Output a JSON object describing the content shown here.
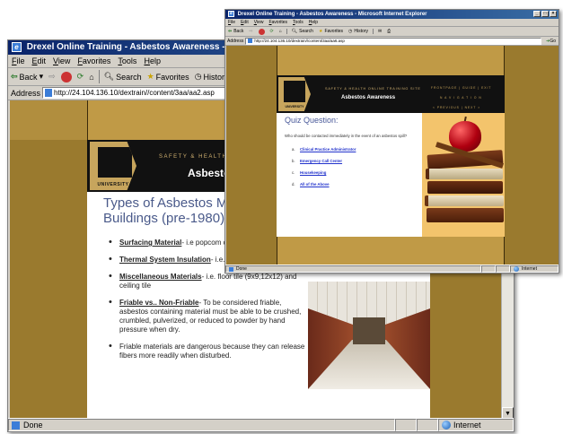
{
  "back_window": {
    "title": "Drexel Online Training - Asbestos Awareness - Microsoft Internet Explorer",
    "menu": [
      "File",
      "Edit",
      "View",
      "Favorites",
      "Tools",
      "Help"
    ],
    "toolbar": {
      "back": "Back",
      "search": "Search",
      "favorites": "Favorites",
      "history": "History"
    },
    "address_label": "Address",
    "address_url": "http://24.104.136.10/dextrain//content/3aa/aa2.asp",
    "status": "Done",
    "zone": "Internet",
    "page": {
      "site_name": "SAFETY & HEALTH ONL",
      "course_title": "Asbestos Aw",
      "logo_text": "UNIVERSITY",
      "heading_line1": "Types of Asbestos Materi",
      "heading_line2": "Buildings (pre-1980)",
      "items": [
        {
          "term": "Surfacing Material",
          "desc": "- i.e popcom ceili"
        },
        {
          "term": "Thermal System Insulation",
          "desc": "- i.e. pip"
        },
        {
          "term": "Miscellaneous Materials",
          "desc": "- i.e. floor tile (9x9,12x12) and ceiling tile"
        },
        {
          "term": "Friable vs.. Non-Friable",
          "desc": "- To be considered friable, asbestos containing material must be able to be crushed, crumbled, pulverized, or reduced to powder by hand pressure when dry."
        },
        {
          "term": "",
          "desc": "Friable materials are dangerous because they can release fibers more readily when disturbed."
        }
      ]
    }
  },
  "front_window": {
    "title": "Drexel Online Training - Asbestos Awareness - Microsoft Internet Explorer",
    "menu": [
      "File",
      "Edit",
      "View",
      "Favorites",
      "Tools",
      "Help"
    ],
    "toolbar": {
      "back": "Back",
      "search": "Search",
      "favorites": "Favorites",
      "history": "History"
    },
    "address_label": "Address",
    "address_url": "http://24.104.136.10/dextrain//content/3aa/aa6.asp",
    "go": "Go",
    "status": "Done",
    "zone": "Internet",
    "page": {
      "site_name": "SAFETY & HEALTH ONLINE TRAINING SITE",
      "course_title": "Asbestos Awareness",
      "logo_text": "UNIVERSITY",
      "nav": {
        "top": "FRONTPAGE | GUIDE | EXIT",
        "middle": "N A V I G A T I O N",
        "bottom": "< PREVIOUS | NEXT >"
      },
      "quiz_title": "Quiz Question:",
      "prompt": "Who should be contacted immediately in the event of an asbestos spill?",
      "options": [
        {
          "letter": "a.",
          "text": "Clinical Practice Administrator"
        },
        {
          "letter": "b.",
          "text": "Emergency Call Center"
        },
        {
          "letter": "c.",
          "text": "Housekeeping"
        },
        {
          "letter": "d.",
          "text": "All of the Above"
        }
      ]
    }
  },
  "colors": {
    "gold_dark": "#9a7a2e",
    "gold_light": "#c09a46",
    "header_black": "#111111",
    "heading_blue": "#4a5a8a",
    "link_blue": "#2233cc",
    "titlebar": "#0a246a"
  }
}
